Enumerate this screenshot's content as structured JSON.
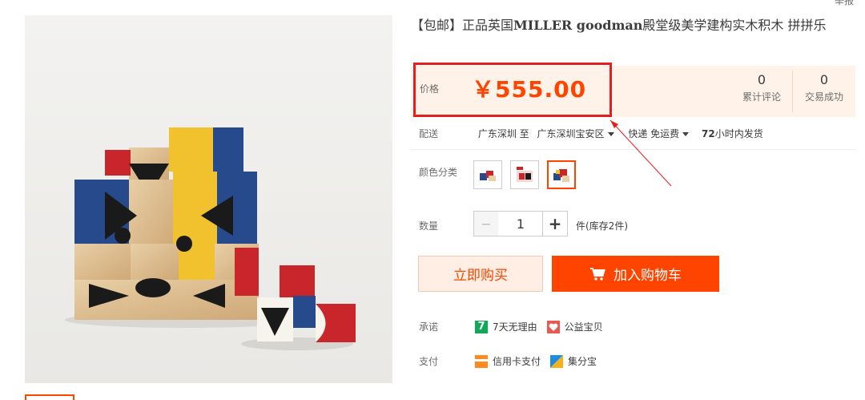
{
  "corner_text": "举报",
  "product": {
    "title_prefix": "【包邮】正品英国",
    "title_brand": "MILLER goodman",
    "title_suffix": "殿堂级美学建构实木积木 拼拼乐",
    "price_label": "价格",
    "price": "￥555.00",
    "stats": [
      {
        "value": "0",
        "label": "累计评论"
      },
      {
        "value": "0",
        "label": "交易成功"
      }
    ]
  },
  "shipping": {
    "label": "配送",
    "from": "广东深圳 至",
    "to": "广东深圳宝安区",
    "method": "快递 免运费",
    "delivery_num": "72",
    "delivery_text": "小时内发货"
  },
  "color": {
    "label": "颜色分类"
  },
  "quantity": {
    "label": "数量",
    "minus": "−",
    "value": "1",
    "plus": "+",
    "stock": "件(库存2件)"
  },
  "actions": {
    "buy_now": "立即购买",
    "add_to_cart": "加入购物车"
  },
  "promise": {
    "label": "承诺",
    "item1_badge": "7",
    "item1": "7天无理由",
    "item2": "公益宝贝"
  },
  "payment": {
    "label": "支付",
    "item1": "信用卡支付",
    "item2": "集分宝"
  },
  "colors": {
    "accent": "#ff4400",
    "highlight_box": "#e4201f",
    "price_bg": "#fff2e8"
  }
}
